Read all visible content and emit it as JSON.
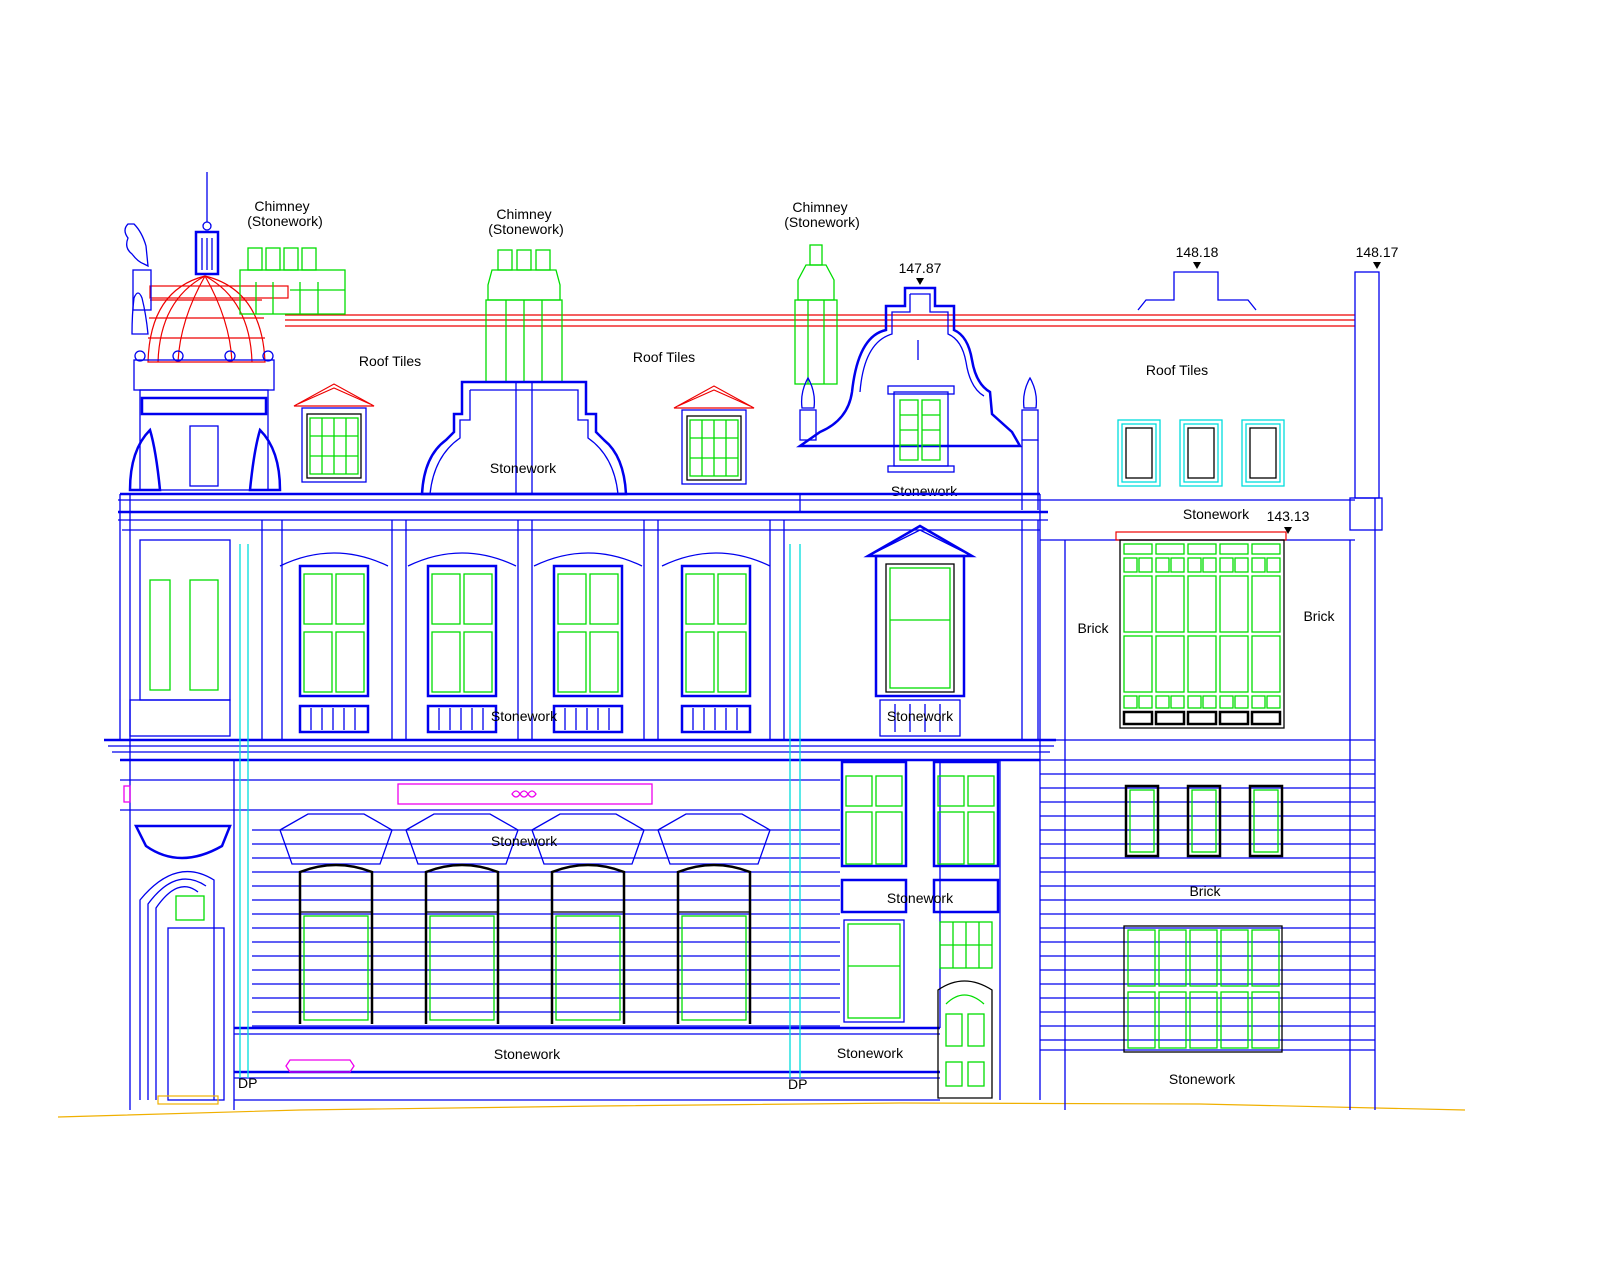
{
  "drawing": {
    "type": "architectural-elevation",
    "colors": {
      "structure": "#0000ee",
      "chimneys_and_glazing": "#00dd00",
      "roof": "#ee0000",
      "rooflights": "#00dddd",
      "signage": "#ee00ee",
      "ground_line": "#f0b000",
      "text": "#000000"
    }
  },
  "labels": {
    "chimney_left": [
      "Chimney",
      "(Stonework)"
    ],
    "chimney_center": [
      "Chimney",
      "(Stonework)"
    ],
    "chimney_right": [
      "Chimney",
      "(Stonework)"
    ],
    "roof_tiles_left": "Roof Tiles",
    "roof_tiles_center": "Roof Tiles",
    "roof_tiles_right": "Roof Tiles",
    "stonework_central_gable": "Stonework",
    "stonework_dutch_gable": "Stonework",
    "stonework_annex_band": "Stonework",
    "brick_annex_left": "Brick",
    "brick_annex_right": "Brick",
    "stonework_first_floor_sill": "Stonework",
    "stonework_bay_sill": "Stonework",
    "stonework_arches": "Stonework",
    "stonework_entrance_frieze": "Stonework",
    "brick_annex_band": "Brick",
    "stonework_plinth_main": "Stonework",
    "stonework_plinth_right": "Stonework",
    "stonework_annex_base": "Stonework",
    "downpipe_left": "DP",
    "downpipe_right": "DP"
  },
  "levels": [
    {
      "id": "gable-top",
      "value": "147.87"
    },
    {
      "id": "annex-parapet",
      "value": "148.18"
    },
    {
      "id": "annex-stack",
      "value": "148.17"
    },
    {
      "id": "annex-window-head",
      "value": "143.13"
    }
  ]
}
